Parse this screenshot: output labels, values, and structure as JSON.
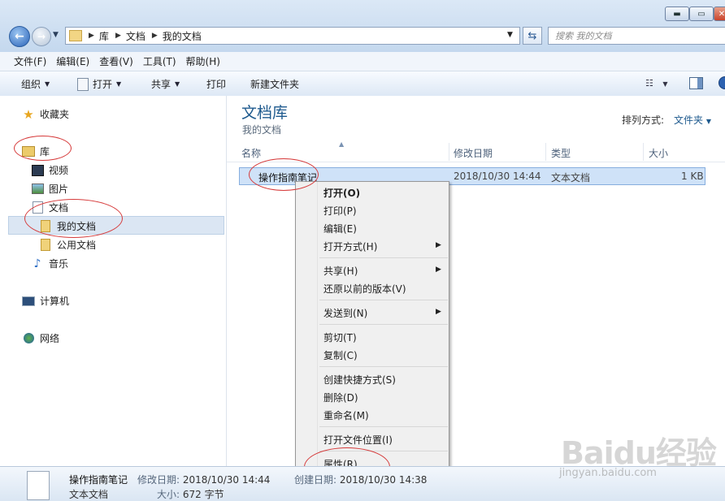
{
  "window": {
    "controls": {
      "minimize": "▬",
      "maximize": "▭",
      "close": "✕"
    }
  },
  "address": {
    "crumbs": [
      "库",
      "我的文档"
    ],
    "root_crumb": "文档",
    "search_placeholder": "搜索 我的文档"
  },
  "menubar": [
    "文件(F)",
    "编辑(E)",
    "查看(V)",
    "工具(T)",
    "帮助(H)"
  ],
  "commands": {
    "organize": "组织",
    "open": "打开",
    "share": "共享",
    "print": "打印",
    "new_folder": "新建文件夹"
  },
  "nav": {
    "favorites": "收藏夹",
    "libraries": "库",
    "videos": "视频",
    "pictures": "图片",
    "documents": "文档",
    "my_documents": "我的文档",
    "public_documents": "公用文档",
    "music": "音乐",
    "computer": "计算机",
    "network": "网络"
  },
  "library": {
    "title": "文档库",
    "subtitle": "我的文档",
    "sort_label": "排列方式:",
    "sort_value": "文件夹"
  },
  "columns": [
    "名称",
    "修改日期",
    "类型",
    "大小"
  ],
  "file": {
    "name": "操作指南笔记",
    "modified": "2018/10/30 14:44",
    "type": "文本文档",
    "size": "1 KB"
  },
  "context_menu": {
    "groups": [
      [
        "打开(O)",
        "打印(P)",
        "编辑(E)",
        "打开方式(H)"
      ],
      [
        "共享(H)",
        "还原以前的版本(V)"
      ],
      [
        "发送到(N)"
      ],
      [
        "剪切(T)",
        "复制(C)"
      ],
      [
        "创建快捷方式(S)",
        "删除(D)",
        "重命名(M)"
      ],
      [
        "打开文件位置(I)"
      ],
      [
        "属性(R)"
      ]
    ]
  },
  "details": {
    "name": "操作指南笔记",
    "type": "文本文档",
    "modified_label": "修改日期:",
    "modified": "2018/10/30 14:44",
    "created_label": "创建日期:",
    "created": "2018/10/30 14:38",
    "size_label": "大小:",
    "size": "672 字节"
  },
  "watermark": {
    "brand": "Baidu经验",
    "url": "jingyan.baidu.com"
  },
  "colors": {
    "annotation": "#d63a3a",
    "accent": "#1e5a8e",
    "selection": "#cfe2f8"
  }
}
